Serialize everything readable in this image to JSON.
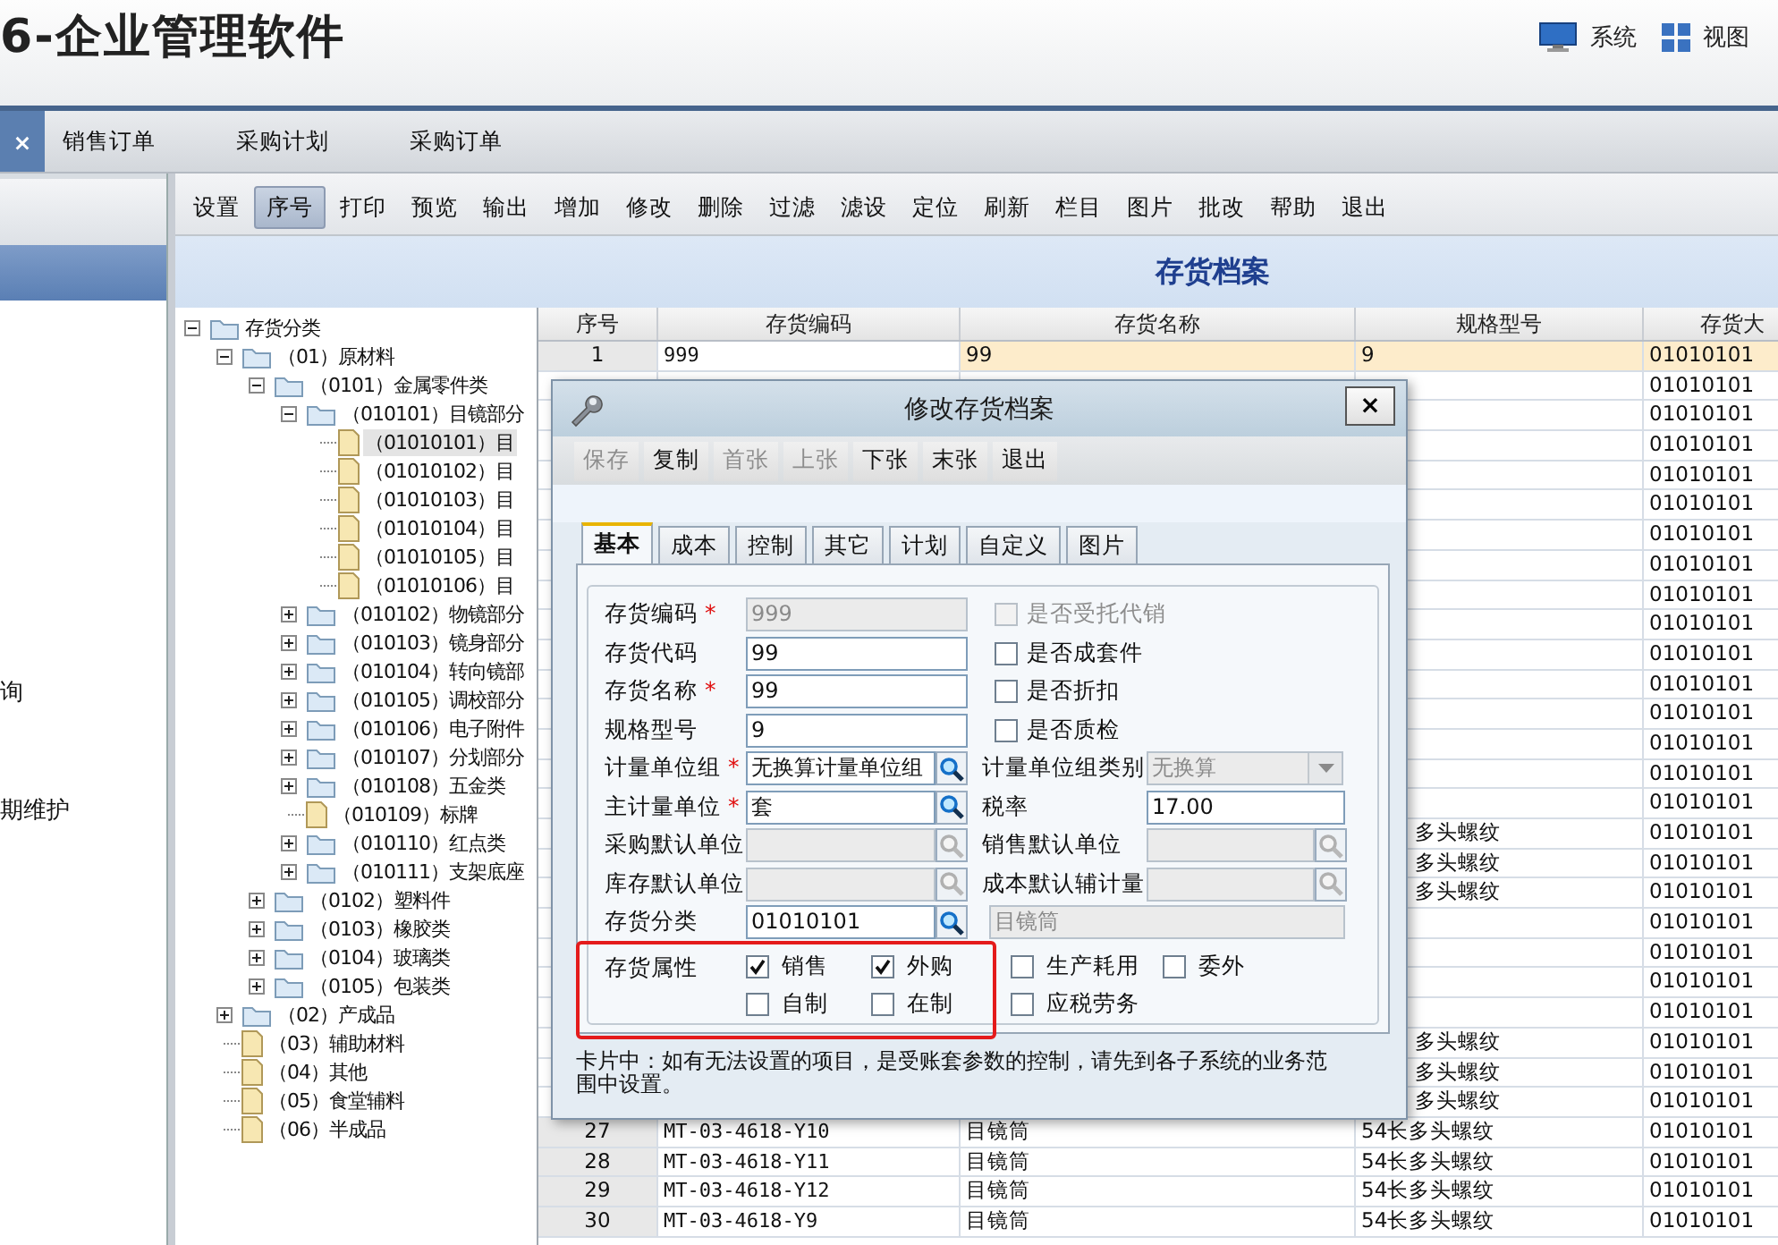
{
  "app_title": "6-企业管理软件",
  "header_menu": [
    {
      "label": "系统",
      "kind": "monitor"
    },
    {
      "label": "视图",
      "kind": "grid"
    }
  ],
  "doc_tabs": [
    {
      "label": "×",
      "selected": true
    },
    {
      "label": "销售订单",
      "selected": false
    },
    {
      "label": "采购计划",
      "selected": false
    },
    {
      "label": "采购订单",
      "selected": false
    }
  ],
  "sidebar": {
    "items": [
      "询",
      "期维护"
    ]
  },
  "toolbar": [
    {
      "label": "设置",
      "selected": false
    },
    {
      "label": "序号",
      "selected": true
    },
    {
      "label": "打印",
      "selected": false
    },
    {
      "label": "预览",
      "selected": false
    },
    {
      "label": "输出",
      "selected": false
    },
    {
      "label": "增加",
      "selected": false
    },
    {
      "label": "修改",
      "selected": false
    },
    {
      "label": "删除",
      "selected": false
    },
    {
      "label": "过滤",
      "selected": false
    },
    {
      "label": "滤设",
      "selected": false
    },
    {
      "label": "定位",
      "selected": false
    },
    {
      "label": "刷新",
      "selected": false
    },
    {
      "label": "栏目",
      "selected": false
    },
    {
      "label": "图片",
      "selected": false
    },
    {
      "label": "批改",
      "selected": false
    },
    {
      "label": "帮助",
      "selected": false
    },
    {
      "label": "退出",
      "selected": false
    }
  ],
  "page_title": "存货档案",
  "tree": [
    {
      "label": "存货分类",
      "kind": "folder",
      "expanded": true,
      "selected": false,
      "children": [
        {
          "label": "（01）原材料",
          "kind": "folder",
          "expanded": true,
          "selected": false,
          "children": [
            {
              "label": "（0101）金属零件类",
              "kind": "folder",
              "expanded": true,
              "selected": false,
              "children": [
                {
                  "label": "（010101）目镜部分",
                  "kind": "folder",
                  "expanded": true,
                  "selected": false,
                  "children": [
                    {
                      "label": "（01010101）目",
                      "kind": "file",
                      "selected": true
                    },
                    {
                      "label": "（01010102）目",
                      "kind": "file",
                      "selected": false
                    },
                    {
                      "label": "（01010103）目",
                      "kind": "file",
                      "selected": false
                    },
                    {
                      "label": "（01010104）目",
                      "kind": "file",
                      "selected": false
                    },
                    {
                      "label": "（01010105）目",
                      "kind": "file",
                      "selected": false
                    },
                    {
                      "label": "（01010106）目",
                      "kind": "file",
                      "selected": false
                    }
                  ]
                },
                {
                  "label": "（010102）物镜部分",
                  "kind": "folder",
                  "expanded": false,
                  "selected": false
                },
                {
                  "label": "（010103）镜身部分",
                  "kind": "folder",
                  "expanded": false,
                  "selected": false
                },
                {
                  "label": "（010104）转向镜部",
                  "kind": "folder",
                  "expanded": false,
                  "selected": false
                },
                {
                  "label": "（010105）调校部分",
                  "kind": "folder",
                  "expanded": false,
                  "selected": false
                },
                {
                  "label": "（010106）电子附件",
                  "kind": "folder",
                  "expanded": false,
                  "selected": false
                },
                {
                  "label": "（010107）分划部分",
                  "kind": "folder",
                  "expanded": false,
                  "selected": false
                },
                {
                  "label": "（010108）五金类",
                  "kind": "folder",
                  "expanded": false,
                  "selected": false
                },
                {
                  "label": "（010109）标牌",
                  "kind": "file",
                  "selected": false
                },
                {
                  "label": "（010110）红点类",
                  "kind": "folder",
                  "expanded": false,
                  "selected": false
                },
                {
                  "label": "（010111）支架底座",
                  "kind": "folder",
                  "expanded": false,
                  "selected": false
                }
              ]
            },
            {
              "label": "（0102）塑料件",
              "kind": "folder",
              "expanded": false,
              "selected": false
            },
            {
              "label": "（0103）橡胶类",
              "kind": "folder",
              "expanded": false,
              "selected": false
            },
            {
              "label": "（0104）玻璃类",
              "kind": "folder",
              "expanded": false,
              "selected": false
            },
            {
              "label": "（0105）包装类",
              "kind": "folder",
              "expanded": false,
              "selected": false
            }
          ]
        },
        {
          "label": "（02）产成品",
          "kind": "folder",
          "expanded": false,
          "selected": false
        },
        {
          "label": "（03）辅助材料",
          "kind": "file",
          "selected": false
        },
        {
          "label": "（04）其他",
          "kind": "file",
          "selected": false
        },
        {
          "label": "（05）食堂辅料",
          "kind": "file",
          "selected": false
        },
        {
          "label": "（06）半成品",
          "kind": "file",
          "selected": false
        }
      ]
    }
  ],
  "table": {
    "columns": [
      "序号",
      "存货编码",
      "存货名称",
      "规格型号",
      "存货大"
    ],
    "rows": [
      {
        "no": "1",
        "code": "999",
        "name": "99",
        "spec": "9",
        "category": "01010101",
        "selected": true
      },
      {
        "category": "01010101",
        "selected": false
      },
      {
        "category": "01010101",
        "selected": false
      },
      {
        "category": "01010101",
        "selected": false
      },
      {
        "category": "01010101",
        "selected": false
      },
      {
        "category": "01010101",
        "selected": false
      },
      {
        "category": "01010101",
        "selected": false
      },
      {
        "category": "01010101",
        "selected": false
      },
      {
        "category": "01010101",
        "selected": false
      },
      {
        "category": "01010101",
        "selected": false
      },
      {
        "category": "01010101",
        "selected": false
      },
      {
        "category": "01010101",
        "selected": false
      },
      {
        "category": "01010101",
        "selected": false
      },
      {
        "category": "01010101",
        "selected": false
      },
      {
        "category": "01010101",
        "selected": false
      },
      {
        "category": "01010101",
        "selected": false
      },
      {
        "spec": "多头螺纹",
        "category": "01010101",
        "selected": false
      },
      {
        "spec": "多头螺纹",
        "category": "01010101",
        "selected": false
      },
      {
        "spec": "多头螺纹",
        "category": "01010101",
        "selected": false
      },
      {
        "category": "01010101",
        "selected": false
      },
      {
        "category": "01010101",
        "selected": false
      },
      {
        "category": "01010101",
        "selected": false
      },
      {
        "category": "01010101",
        "selected": false
      },
      {
        "spec": "多头螺纹",
        "category": "01010101",
        "selected": false
      },
      {
        "spec": "多头螺纹",
        "category": "01010101",
        "selected": false
      },
      {
        "spec": "多头螺纹",
        "category": "01010101",
        "selected": false
      },
      {
        "no": "27",
        "code": "MT-03-4618-Y10",
        "name": "目镜筒",
        "spec": "54长多头螺纹",
        "category": "01010101",
        "selected": false
      },
      {
        "no": "28",
        "code": "MT-03-4618-Y11",
        "name": "目镜筒",
        "spec": "54长多头螺纹",
        "category": "01010101",
        "selected": false
      },
      {
        "no": "29",
        "code": "MT-03-4618-Y12",
        "name": "目镜筒",
        "spec": "54长多头螺纹",
        "category": "01010101",
        "selected": false
      },
      {
        "no": "30",
        "code": "MT-03-4618-Y9",
        "name": "目镜筒",
        "spec": "54长多头螺纹",
        "category": "01010101",
        "selected": false
      }
    ]
  },
  "dialog": {
    "title": "修改存货档案",
    "close": "×",
    "toolbar": [
      {
        "label": "保存",
        "disabled": true
      },
      {
        "label": "复制",
        "disabled": false
      },
      {
        "label": "首张",
        "disabled": true
      },
      {
        "label": "上张",
        "disabled": true
      },
      {
        "label": "下张",
        "disabled": false
      },
      {
        "label": "末张",
        "disabled": false
      },
      {
        "label": "退出",
        "disabled": false
      }
    ],
    "tabs": [
      {
        "label": "基本",
        "selected": true
      },
      {
        "label": "成本",
        "selected": false
      },
      {
        "label": "控制",
        "selected": false
      },
      {
        "label": "其它",
        "selected": false
      },
      {
        "label": "计划",
        "selected": false
      },
      {
        "label": "自定义",
        "selected": false
      },
      {
        "label": "图片",
        "selected": false
      }
    ],
    "left_fields": [
      {
        "label": "存货编码",
        "mark": "*",
        "kind": "text",
        "value": "999",
        "disabled": true
      },
      {
        "label": "存货代码",
        "kind": "text",
        "value": "99",
        "disabled": false
      },
      {
        "label": "存货名称",
        "mark": "*",
        "kind": "text",
        "value": "99",
        "disabled": false
      },
      {
        "label": "规格型号",
        "kind": "text",
        "value": "9",
        "disabled": false
      },
      {
        "label": "计量单位组",
        "mark": "*",
        "kind": "lookup",
        "value": "无换算计量单位组",
        "disabled": false
      },
      {
        "label": "主计量单位",
        "mark": "*",
        "kind": "lookup",
        "value": "套",
        "disabled": false
      },
      {
        "label": "采购默认单位",
        "kind": "lookup",
        "disabled": true
      },
      {
        "label": "库存默认单位",
        "kind": "lookup",
        "disabled": true
      },
      {
        "label": "存货分类",
        "kind": "lookup",
        "value": "01010101",
        "disabled": false
      }
    ],
    "right_items": [
      {
        "kind": "checkbox",
        "label": "是否受托代销",
        "checked": false,
        "disabled": true
      },
      {
        "kind": "checkbox",
        "label": "是否成套件",
        "checked": false,
        "disabled": false
      },
      {
        "kind": "checkbox",
        "label": "是否折扣",
        "checked": false,
        "disabled": false
      },
      {
        "kind": "checkbox",
        "label": "是否质检",
        "checked": false,
        "disabled": false
      },
      {
        "kind": "select",
        "label": "计量单位组类别",
        "value": "无换算",
        "disabled": true
      },
      {
        "kind": "text",
        "label": "税率",
        "value": "17.00",
        "disabled": false
      },
      {
        "kind": "lookup",
        "label": "销售默认单位",
        "disabled": true
      },
      {
        "kind": "lookup",
        "label": "成本默认辅计量",
        "disabled": true
      },
      {
        "kind": "display",
        "value": "目镜筒",
        "disabled": true
      }
    ],
    "attributes": {
      "label": "存货属性",
      "options": [
        {
          "label": "销售",
          "checked": true
        },
        {
          "label": "外购",
          "checked": true
        },
        {
          "label": "生产耗用",
          "checked": false
        },
        {
          "label": "委外",
          "checked": false
        },
        {
          "label": "自制",
          "checked": false
        },
        {
          "label": "在制",
          "checked": false
        },
        {
          "label": "应税劳务",
          "checked": false
        }
      ]
    },
    "note": "卡片中：如有无法设置的项目，是受账套参数的控制，请先到各子系统的业务范围中设置。"
  }
}
